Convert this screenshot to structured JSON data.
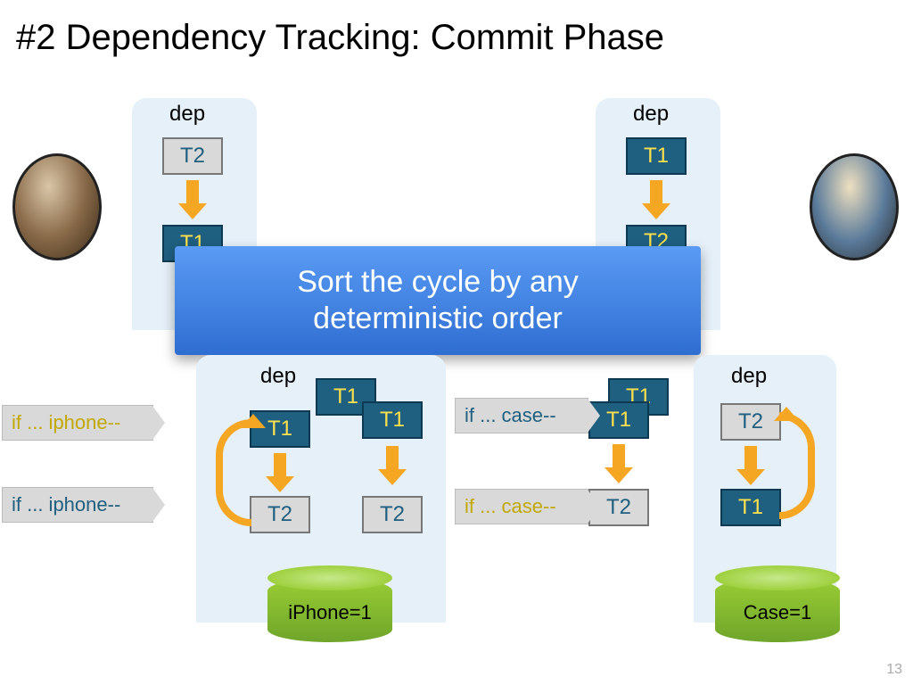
{
  "title": "#2 Dependency Tracking: Commit Phase",
  "dep_label": "dep",
  "boxes": {
    "T1": "T1",
    "T2": "T2"
  },
  "callout": {
    "line1": "Sort the cycle by any",
    "line2": "deterministic order"
  },
  "tags": {
    "iphone_hi": "if ... iphone--",
    "iphone": "if ... iphone--",
    "case_hi": "if ... case--",
    "case": "if ... case--"
  },
  "cyl": {
    "iphone": "iPhone=1",
    "case": "Case=1"
  },
  "slide_num": "13"
}
